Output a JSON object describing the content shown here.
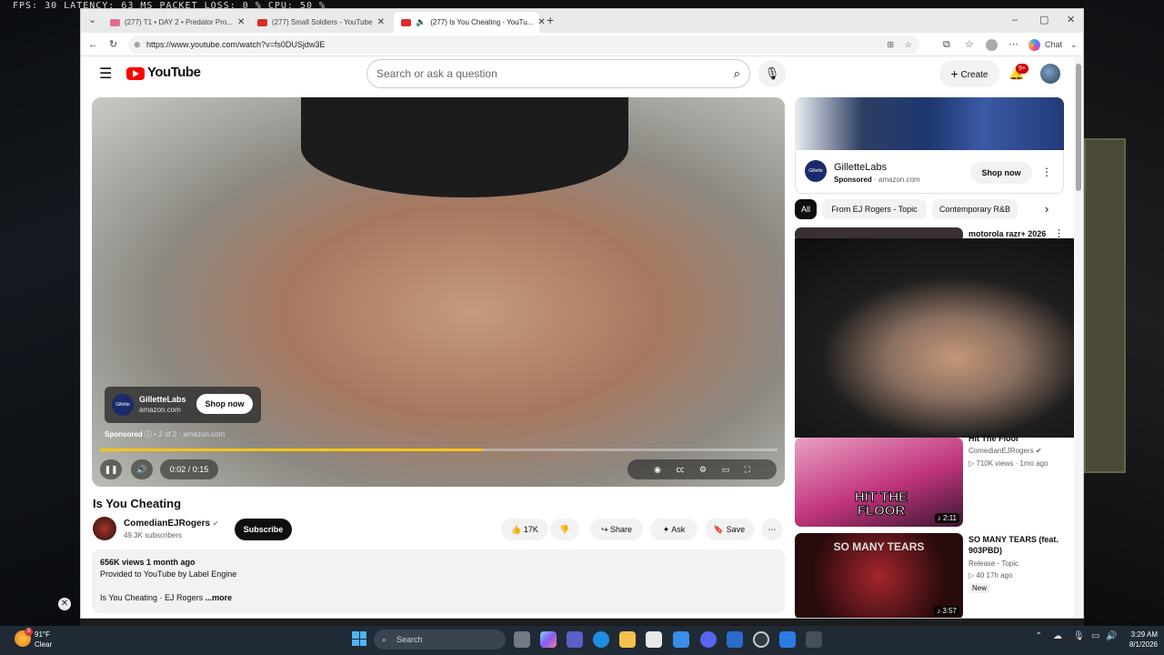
{
  "overlay": {
    "fps_text": "FPS:  30  LATENCY: 63 MS  PACKET LOSS: 0 %  CPU: 50 %"
  },
  "browser": {
    "tabs": [
      {
        "title": "(277) T1 • DAY 2 • Predator Pro..."
      },
      {
        "title": "(277) Small Soldiers - YouTube"
      },
      {
        "title": "(277) Is You Cheating - YouTu..."
      }
    ],
    "url": "https://www.youtube.com/watch?v=fs0DUSjdw3E",
    "chat_label": "Chat"
  },
  "youtube": {
    "logo_text": "YouTube",
    "search_placeholder": "Search or ask a question",
    "create_label": "Create",
    "notif_badge": "9+"
  },
  "player": {
    "ad_brand": "GilletteLabs",
    "ad_domain": "amazon.com",
    "ad_shop_label": "Shop now",
    "ad_sponsored": "Sponsored",
    "ad_count": "• 2 of 2 ·",
    "ad_domain2": "amazon.com",
    "time": "0:02 / 0:15",
    "progress": 0.565
  },
  "video": {
    "title": "Is You Cheating",
    "channel": "ComedianEJRogers",
    "subscribers": "49.3K subscribers",
    "subscribe_label": "Subscribe",
    "likes": "17K",
    "share_label": "Share",
    "ask_label": "Ask",
    "save_label": "Save",
    "views_line": "656K views  1 month ago",
    "provided": "Provided to YouTube by Label Engine",
    "desc_snippet": "Is You Cheating · EJ Rogers",
    "more_label": "...more"
  },
  "sidebar": {
    "ad_brand": "GilletteLabs",
    "ad_sponsored": "Sponsored",
    "ad_domain": "amazon.com",
    "ad_shop_label": "Shop now",
    "chips": [
      "All",
      "From EJ Rogers - Topic",
      "Contemporary R&B"
    ],
    "items": [
      {
        "title": "motorola razr+ 2026"
      },
      {
        "title": "Hit The Floor",
        "channel": "ComedianEJRogers",
        "meta": "710K views · 1mo ago",
        "duration": "2:11",
        "thumb_text": "HIT THE FLOOR"
      },
      {
        "title": "SO MANY TEARS (feat. 903PBD)",
        "channel": "Release - Topic",
        "meta": "40  17h ago",
        "badge": "New",
        "duration": "3:57",
        "thumb_text": "SO MANY TEARS"
      }
    ]
  },
  "taskbar": {
    "weather_temp": "91°F",
    "weather_cond": "Clear",
    "weather_badge": "3",
    "search_label": "Search",
    "time": "3:29 AM",
    "date": "8/1/2026"
  }
}
